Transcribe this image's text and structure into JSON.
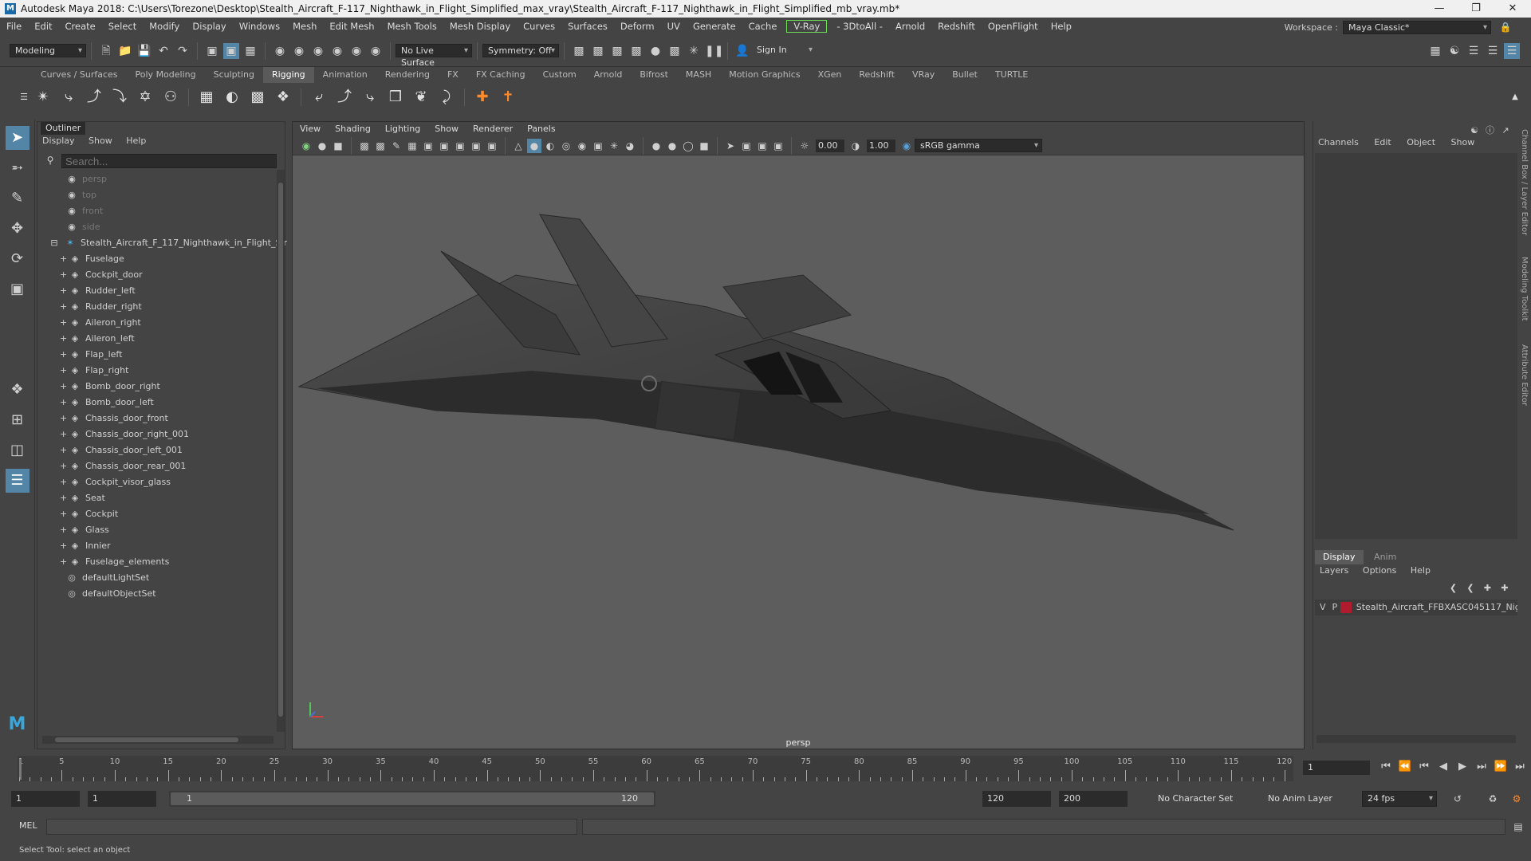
{
  "title": "Autodesk Maya 2018: C:\\Users\\Torezone\\Desktop\\Stealth_Aircraft_F-117_Nighthawk_in_Flight_Simplified_max_vray\\Stealth_Aircraft_F-117_Nighthawk_in_Flight_Simplified_mb_vray.mb*",
  "menu": [
    "File",
    "Edit",
    "Create",
    "Select",
    "Modify",
    "Display",
    "Windows",
    "Mesh",
    "Edit Mesh",
    "Mesh Tools",
    "Mesh Display",
    "Curves",
    "Surfaces",
    "Deform",
    "UV",
    "Generate",
    "Cache"
  ],
  "menu_vray": "V-Ray",
  "menu2": [
    "- 3DtoAll -",
    "Arnold",
    "Redshift",
    "OpenFlight",
    "Help"
  ],
  "workspace_label": "Workspace :",
  "workspace_value": "Maya Classic*",
  "status": {
    "mode": "Modeling",
    "live_surface": "No Live Surface",
    "symmetry": "Symmetry: Off",
    "sign_in": "Sign In"
  },
  "shelf_tabs": [
    "Curves / Surfaces",
    "Poly Modeling",
    "Sculpting",
    "Rigging",
    "Animation",
    "Rendering",
    "FX",
    "FX Caching",
    "Custom",
    "Arnold",
    "Bifrost",
    "MASH",
    "Motion Graphics",
    "XGen",
    "Redshift",
    "VRay",
    "Bullet",
    "TURTLE"
  ],
  "shelf_active": "Rigging",
  "outliner": {
    "tab": "Outliner",
    "menu": [
      "Display",
      "Show",
      "Help"
    ],
    "search_placeholder": "Search...",
    "cameras": [
      "persp",
      "top",
      "front",
      "side"
    ],
    "root": "Stealth_Aircraft_F_117_Nighthawk_in_Flight_Sir",
    "children": [
      "Fuselage",
      "Cockpit_door",
      "Rudder_left",
      "Rudder_right",
      "Aileron_right",
      "Aileron_left",
      "Flap_left",
      "Flap_right",
      "Bomb_door_right",
      "Bomb_door_left",
      "Chassis_door_front",
      "Chassis_door_right_001",
      "Chassis_door_left_001",
      "Chassis_door_rear_001",
      "Cockpit_visor_glass",
      "Seat",
      "Cockpit",
      "Glass",
      "Innier",
      "Fuselage_elements"
    ],
    "sets": [
      "defaultLightSet",
      "defaultObjectSet"
    ]
  },
  "viewport": {
    "menu": [
      "View",
      "Shading",
      "Lighting",
      "Show",
      "Renderer",
      "Panels"
    ],
    "exposure": "0.00",
    "gamma": "1.00",
    "colorspace": "sRGB gamma",
    "camera": "persp"
  },
  "channelbox": {
    "menu": [
      "Channels",
      "Edit",
      "Object",
      "Show"
    ],
    "layer_tabs": [
      "Display",
      "Anim"
    ],
    "layer_menu": [
      "Layers",
      "Options",
      "Help"
    ],
    "layer_v": "V",
    "layer_p": "P",
    "layer_name": "Stealth_Aircraft_FFBXASC045117_Nigl",
    "layer_color": "#b01b2e"
  },
  "side_tabs": [
    "Channel Box / Layer Editor",
    "Modeling Toolkit",
    "Attribute Editor"
  ],
  "timeline": {
    "ticks": [
      5,
      10,
      15,
      20,
      25,
      30,
      35,
      40,
      45,
      50,
      55,
      60,
      65,
      70,
      75,
      80,
      85,
      90,
      95,
      100,
      105,
      110,
      115,
      120
    ],
    "start_label": "1",
    "current_frame": "1"
  },
  "range": {
    "start": "1",
    "playback_start": "1",
    "bar_start": "1",
    "bar_end": "120",
    "playback_end": "120",
    "end": "200",
    "character_set": "No Character Set",
    "anim_layer": "No Anim Layer",
    "fps": "24 fps"
  },
  "cmd": {
    "label": "MEL"
  },
  "help": "Select Tool: select an object"
}
